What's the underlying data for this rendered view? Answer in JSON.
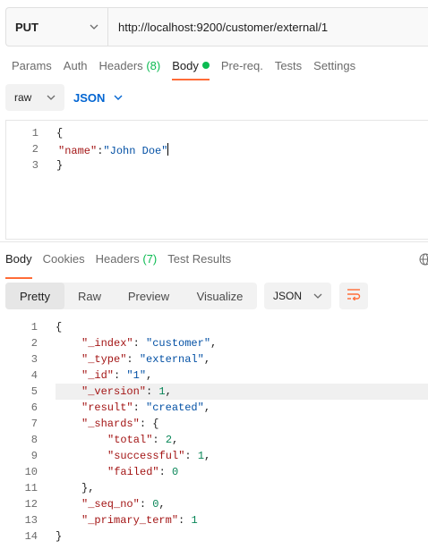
{
  "request": {
    "method": "PUT",
    "url": "http://localhost:9200/customer/external/1"
  },
  "request_tabs": [
    {
      "label": "Params"
    },
    {
      "label": "Auth"
    },
    {
      "label": "Headers",
      "count": "(8)"
    },
    {
      "label": "Body"
    },
    {
      "label": "Pre-req."
    },
    {
      "label": "Tests"
    },
    {
      "label": "Settings"
    }
  ],
  "body_mode": {
    "type": "raw",
    "format": "JSON"
  },
  "request_body": {
    "line_numbers": [
      "1",
      "2",
      "3"
    ],
    "open": "{",
    "key": "\"name\"",
    "colon": ":",
    "value": "\"John Doe\"",
    "close": "}"
  },
  "response_tabs": [
    {
      "label": "Body"
    },
    {
      "label": "Cookies"
    },
    {
      "label": "Headers",
      "count": "(7)"
    },
    {
      "label": "Test Results"
    }
  ],
  "view_modes": [
    "Pretty",
    "Raw",
    "Preview",
    "Visualize"
  ],
  "response_format": "JSON",
  "response_body": {
    "line_numbers": [
      "1",
      "2",
      "3",
      "4",
      "5",
      "6",
      "7",
      "8",
      "9",
      "10",
      "11",
      "12",
      "13",
      "14"
    ],
    "lines": [
      {
        "t": "{"
      },
      {
        "k": "\"_index\"",
        "v": "\"customer\"",
        "vt": "s",
        "end": ","
      },
      {
        "k": "\"_type\"",
        "v": "\"external\"",
        "vt": "s",
        "end": ","
      },
      {
        "k": "\"_id\"",
        "v": "\"1\"",
        "vt": "s",
        "end": ","
      },
      {
        "k": "\"_version\"",
        "v": "1",
        "vt": "n",
        "end": ","
      },
      {
        "k": "\"result\"",
        "v": "\"created\"",
        "vt": "s",
        "end": ","
      },
      {
        "k": "\"_shards\"",
        "v": "{",
        "vt": "p",
        "end": ""
      },
      {
        "k": "\"total\"",
        "v": "2",
        "vt": "n",
        "end": ","
      },
      {
        "k": "\"successful\"",
        "v": "1",
        "vt": "n",
        "end": ","
      },
      {
        "k": "\"failed\"",
        "v": "0",
        "vt": "n",
        "end": ""
      },
      {
        "t": "},"
      },
      {
        "k": "\"_seq_no\"",
        "v": "0",
        "vt": "n",
        "end": ","
      },
      {
        "k": "\"_primary_term\"",
        "v": "1",
        "vt": "n",
        "end": ""
      },
      {
        "t": "}"
      }
    ]
  },
  "colors": {
    "accent": "#ff6c37",
    "success": "#0cbb52",
    "link": "#0265d2"
  },
  "icons": [
    "chevron-down-icon",
    "status-dot-icon",
    "globe-icon",
    "wrap-lines-icon"
  ]
}
